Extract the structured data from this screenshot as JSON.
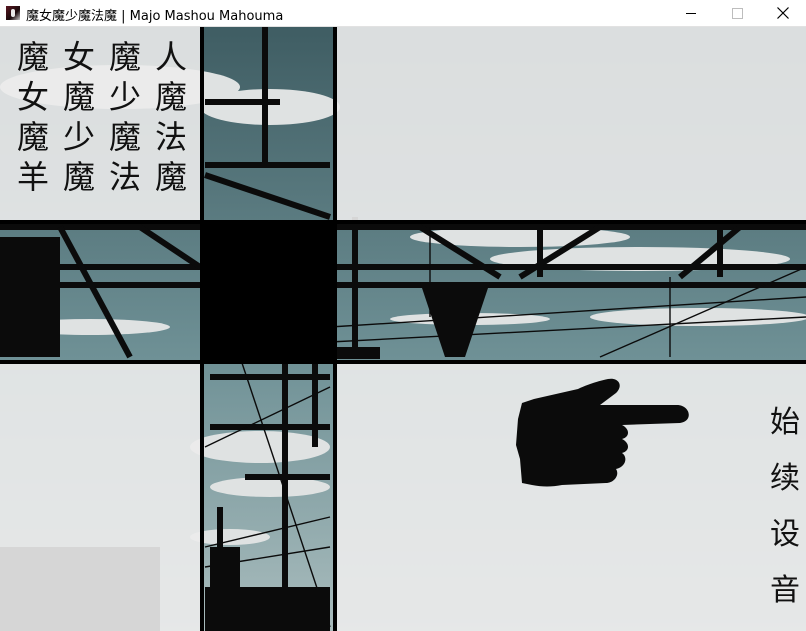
{
  "window": {
    "title": "魔女魔少魔法魔 | Majo Mashou Mahouma",
    "icon": "app-icon",
    "controls": {
      "minimize": "minimize-icon",
      "maximize": "maximize-icon",
      "close": "close-icon"
    }
  },
  "title_grid": {
    "rows": [
      [
        "魔",
        "女",
        "魔",
        "人"
      ],
      [
        "女",
        "魔",
        "少",
        "魔"
      ],
      [
        "魔",
        "少",
        "魔",
        "法"
      ],
      [
        "羊",
        "魔",
        "法",
        "魔"
      ]
    ]
  },
  "menu": {
    "items": [
      {
        "label": "始",
        "name": "menu-start"
      },
      {
        "label": "续",
        "name": "menu-continue"
      },
      {
        "label": "设",
        "name": "menu-settings"
      },
      {
        "label": "音",
        "name": "menu-sound"
      }
    ]
  },
  "cursor": {
    "icon": "pointing-hand-icon"
  },
  "colors": {
    "sky": "#5d7f85",
    "cloud": "#dfe2e2",
    "silhouette": "#0b0b0b",
    "fade": "#ececec"
  }
}
